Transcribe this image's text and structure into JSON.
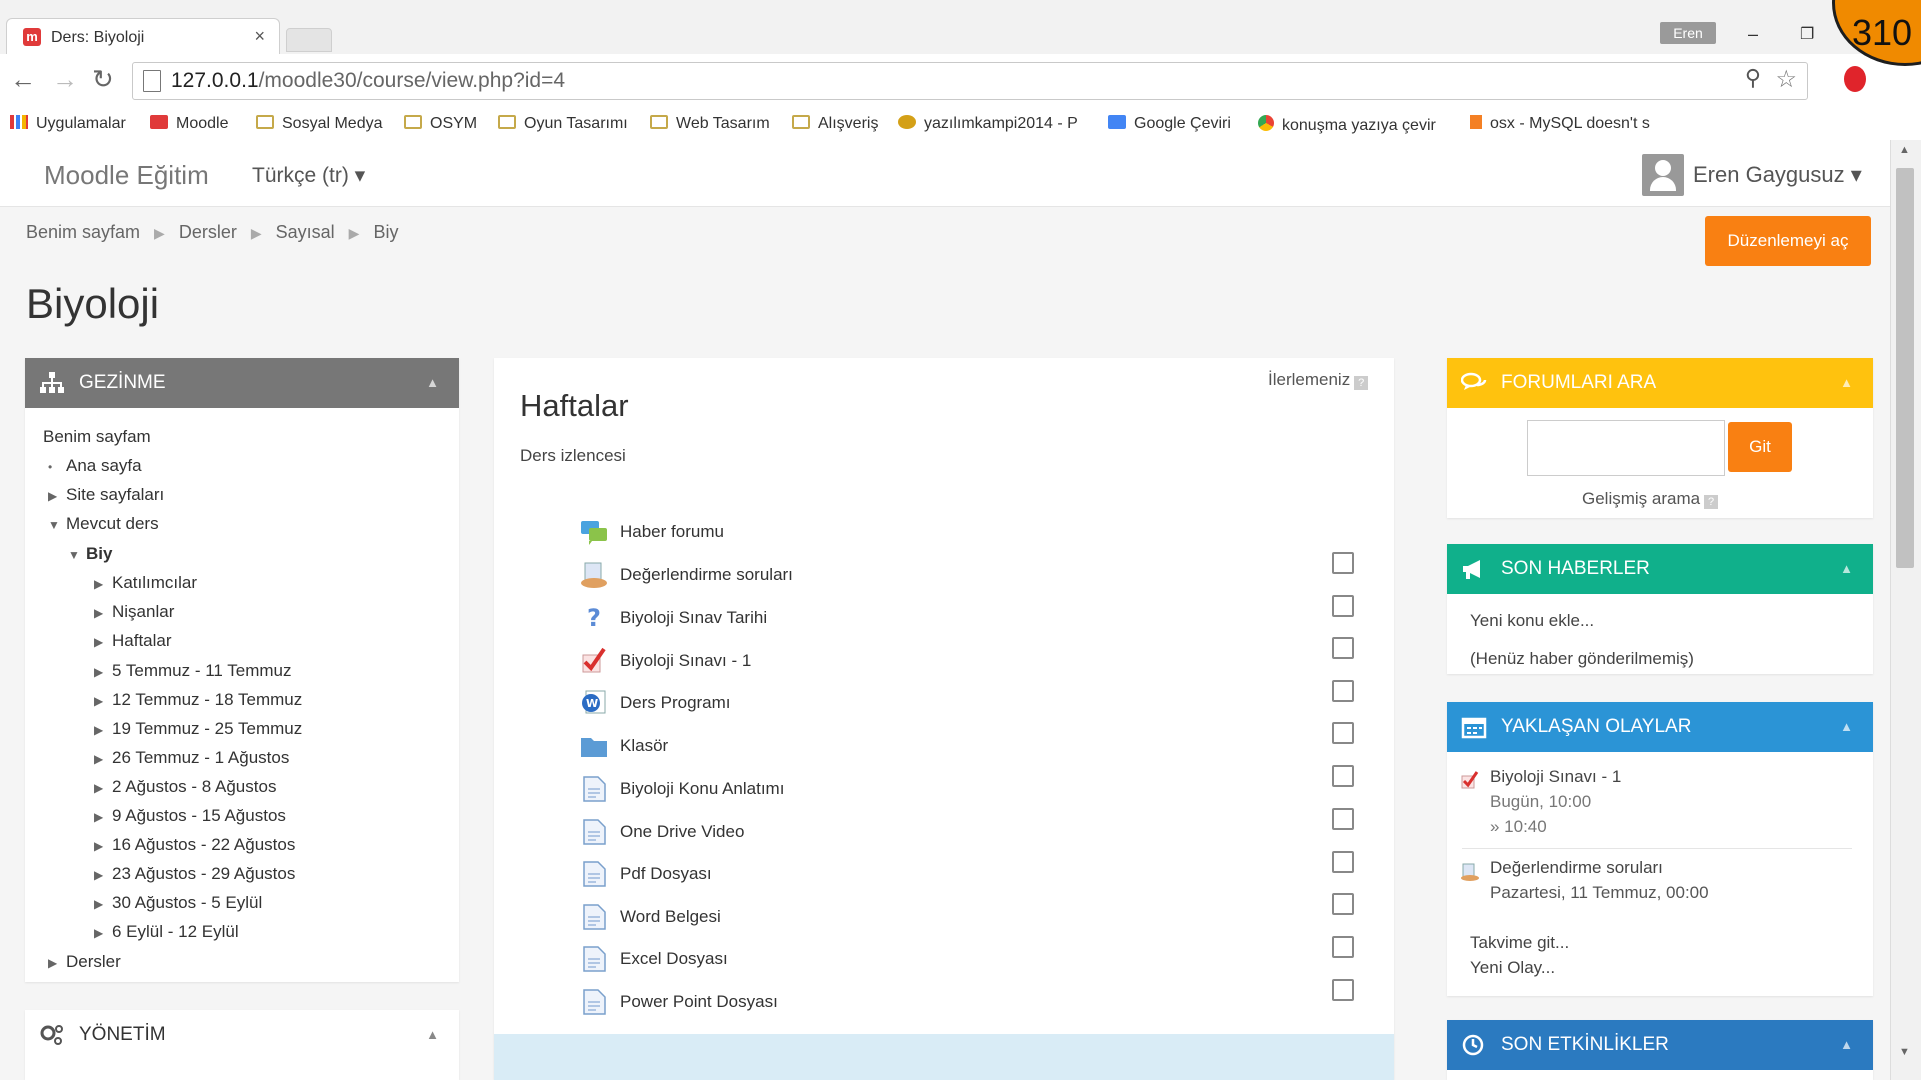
{
  "browser": {
    "tab_title": "Ders: Biyoloji",
    "tab_close": "×",
    "profile_chip": "Eren",
    "url_host": "127.0.0.1",
    "url_path": "/moodle30/course/view.php?id=4",
    "bookmarks": [
      "Uygulamalar",
      "Moodle",
      "Sosyal Medya",
      "OSYM",
      "Oyun Tasarımı",
      "Web Tasarım",
      "Alışveriş",
      "yazılımkampi2014 - P",
      "Google Çeviri",
      "konuşma yazıya çevir",
      "osx - MySQL doesn't s"
    ]
  },
  "badge": "310",
  "navbar": {
    "brand": "Moodle Eğitim",
    "language": "Türkçe (tr) ▾",
    "user": "Eren Gaygusuz ▾"
  },
  "breadcrumb": [
    "Benim sayfam",
    "Dersler",
    "Sayısal",
    "Biy"
  ],
  "breadcrumb_sep": "▶",
  "edit_button": "Düzenlemeyi aç",
  "page_title": "Biyoloji",
  "navigation_block": {
    "title": "GEZİNME",
    "items": [
      {
        "label": "Benim sayfam",
        "twisty": ""
      },
      {
        "label": "Ana sayfa",
        "twisty": "•"
      },
      {
        "label": "Site sayfaları",
        "twisty": "▶"
      },
      {
        "label": "Mevcut ders",
        "twisty": "▼"
      },
      {
        "label": "Biy",
        "twisty": "▼"
      },
      {
        "label": "Katılımcılar",
        "twisty": "▶"
      },
      {
        "label": "Nişanlar",
        "twisty": "▶"
      },
      {
        "label": "Haftalar",
        "twisty": "▶"
      },
      {
        "label": "5 Temmuz - 11 Temmuz",
        "twisty": "▶"
      },
      {
        "label": "12 Temmuz - 18 Temmuz",
        "twisty": "▶"
      },
      {
        "label": "19 Temmuz - 25 Temmuz",
        "twisty": "▶"
      },
      {
        "label": "26 Temmuz - 1 Ağustos",
        "twisty": "▶"
      },
      {
        "label": "2 Ağustos - 8 Ağustos",
        "twisty": "▶"
      },
      {
        "label": "9 Ağustos - 15 Ağustos",
        "twisty": "▶"
      },
      {
        "label": "16 Ağustos - 22 Ağustos",
        "twisty": "▶"
      },
      {
        "label": "23 Ağustos - 29 Ağustos",
        "twisty": "▶"
      },
      {
        "label": "30 Ağustos - 5 Eylül",
        "twisty": "▶"
      },
      {
        "label": "6 Eylül - 12 Eylül",
        "twisty": "▶"
      },
      {
        "label": "Dersler",
        "twisty": "▶"
      }
    ]
  },
  "admin_block": {
    "title": "YÖNETİM"
  },
  "main": {
    "progress_label": "İlerlemeniz",
    "help_mark": "?",
    "section_title": "Haftalar",
    "section_summary": "Ders izlencesi",
    "activities": [
      {
        "label": "Haber forumu",
        "icon": "forum-icon",
        "checkbox": false
      },
      {
        "label": "Değerlendirme soruları",
        "icon": "feedback-icon",
        "checkbox": true
      },
      {
        "label": "Biyoloji Sınav Tarihi",
        "icon": "question-icon",
        "checkbox": true
      },
      {
        "label": "Biyoloji Sınavı - 1",
        "icon": "quiz-icon",
        "checkbox": true
      },
      {
        "label": "Ders Programı",
        "icon": "word-document-icon",
        "checkbox": true
      },
      {
        "label": "Klasör",
        "icon": "folder-icon",
        "checkbox": true
      },
      {
        "label": "Biyoloji Konu Anlatımı",
        "icon": "page-icon",
        "checkbox": true
      },
      {
        "label": "One Drive Video",
        "icon": "page-icon",
        "checkbox": true
      },
      {
        "label": "Pdf Dosyası",
        "icon": "page-icon",
        "checkbox": true
      },
      {
        "label": "Word Belgesi",
        "icon": "page-icon",
        "checkbox": true
      },
      {
        "label": "Excel Dosyası",
        "icon": "page-icon",
        "checkbox": true
      },
      {
        "label": "Power Point Dosyası",
        "icon": "page-icon",
        "checkbox": true
      }
    ]
  },
  "forum_search_block": {
    "title": "FORUMLARI ARA",
    "go_button": "Git",
    "advanced": "Gelişmiş arama",
    "input_value": ""
  },
  "news_block": {
    "title": "SON HABERLER",
    "add_topic": "Yeni konu ekle...",
    "empty": "(Henüz haber gönderilmemiş)"
  },
  "events_block": {
    "title": "YAKLAŞAN OLAYLAR",
    "event1_name": "Biyoloji Sınavı - 1",
    "event1_date": "Bugün, 10:00",
    "event1_end": "» 10:40",
    "event2_name": "Değerlendirme soruları",
    "event2_date": "Pazartesi, 11 Temmuz, 00:00",
    "goto_calendar": "Takvime git...",
    "new_event": "Yeni Olay..."
  },
  "activity_block": {
    "title": "SON ETKİNLİKLER"
  },
  "colors": {
    "accent": "#f98012",
    "nav_header": "#777777",
    "forum_header": "#ffc20e",
    "news_header": "#10b08b",
    "events_header": "#2b94d6"
  }
}
